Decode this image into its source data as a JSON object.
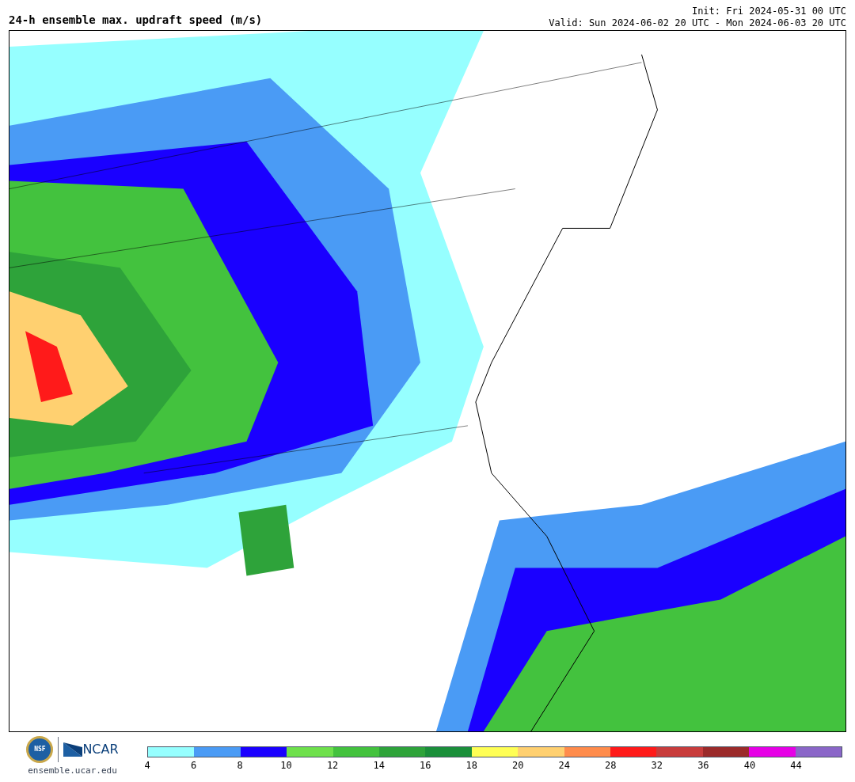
{
  "title": "24-h ensemble max. updraft speed (m/s)",
  "init": "Init: Fri 2024-05-31 00 UTC",
  "valid": "Valid: Sun 2024-06-02 20 UTC - Mon 2024-06-03 20 UTC",
  "footer": {
    "seal_text": "NSF",
    "logo_text": "NCAR",
    "url": "ensemble.ucar.edu"
  },
  "colorbar": {
    "bins": [
      {
        "color": "#96ffff"
      },
      {
        "color": "#4a9bf5"
      },
      {
        "color": "#1a00ff"
      },
      {
        "color": "#6ee04c"
      },
      {
        "color": "#43c23e"
      },
      {
        "color": "#2ea33a"
      },
      {
        "color": "#1a8f3a"
      },
      {
        "color": "#ffff55"
      },
      {
        "color": "#ffd070"
      },
      {
        "color": "#ff8c4c"
      },
      {
        "color": "#ff1a1a"
      },
      {
        "color": "#c83c3c"
      },
      {
        "color": "#9b2a2a"
      },
      {
        "color": "#e600e6"
      },
      {
        "color": "#8a66c8"
      }
    ],
    "ticks": [
      "4",
      "6",
      "8",
      "10",
      "12",
      "14",
      "16",
      "18",
      "20",
      "24",
      "28",
      "32",
      "36",
      "40",
      "44"
    ]
  }
}
